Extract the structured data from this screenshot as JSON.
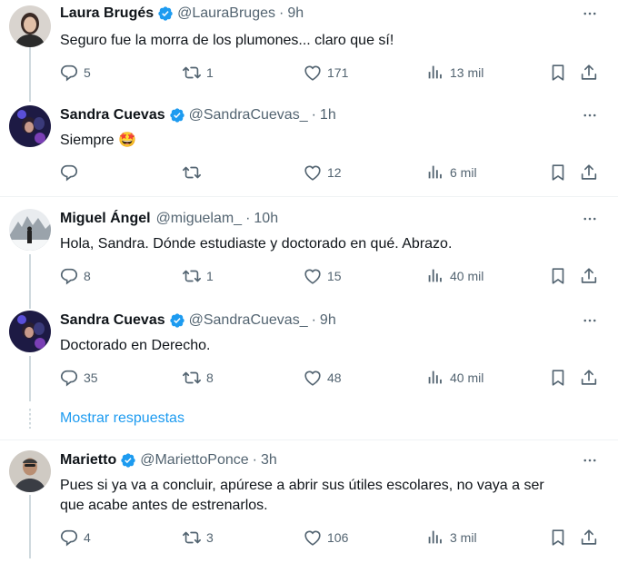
{
  "tweets": [
    {
      "name": "Laura Brugés",
      "handle": "@LauraBruges",
      "time": "9h",
      "text": "Seguro fue la morra de los plumones... claro que sí!",
      "replies": "5",
      "retweets": "1",
      "likes": "171",
      "views": "13 mil",
      "verified": true
    },
    {
      "name": "Sandra Cuevas",
      "handle": "@SandraCuevas_",
      "time": "1h",
      "text": "Siempre 🤩",
      "replies": "",
      "retweets": "",
      "likes": "12",
      "views": "6 mil",
      "verified": true
    },
    {
      "name": "Miguel Ángel",
      "handle": "@miguelam_",
      "time": "10h",
      "text": "Hola, Sandra. Dónde estudiaste y doctorado en qué. Abrazo.",
      "replies": "8",
      "retweets": "1",
      "likes": "15",
      "views": "40 mil",
      "verified": false
    },
    {
      "name": "Sandra Cuevas",
      "handle": "@SandraCuevas_",
      "time": "9h",
      "text": "Doctorado en Derecho.",
      "replies": "35",
      "retweets": "8",
      "likes": "48",
      "views": "40 mil",
      "verified": true
    },
    {
      "name": "Marietto",
      "handle": "@MariettoPonce",
      "time": "3h",
      "text_line1": "Pues si ya va a concluir, apúrese a abrir sus útiles escolares, no vaya a ser",
      "text_line2": "que acabe antes de estrenarlos.",
      "replies": "4",
      "retweets": "3",
      "likes": "106",
      "views": "3 mil",
      "verified": true
    }
  ],
  "show_replies": "Mostrar respuestas",
  "separator": "·",
  "colors": {
    "accent": "#1d9bf0",
    "muted": "#536471",
    "text": "#0f1419",
    "line": "#cfd9de"
  }
}
